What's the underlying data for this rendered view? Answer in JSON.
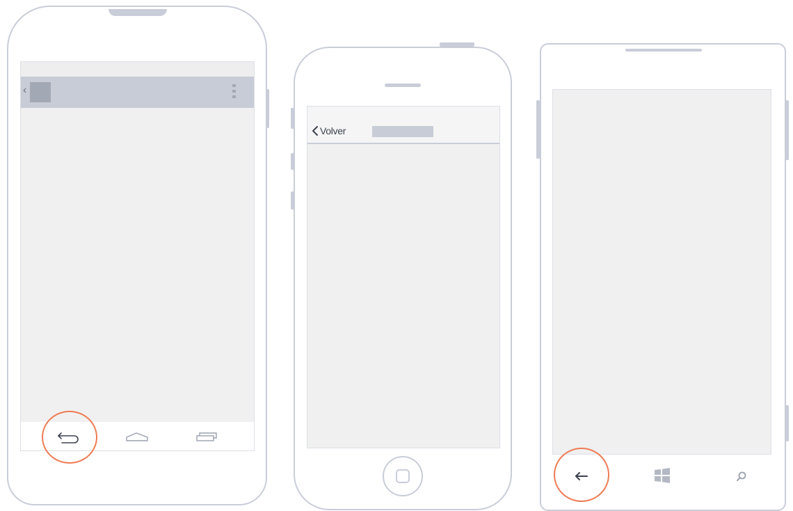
{
  "devices": {
    "android": {
      "buttons": [
        "back",
        "home",
        "recent-apps"
      ],
      "highlighted_button": "back"
    },
    "iphone": {
      "back_label": "Volver"
    },
    "windows_phone": {
      "buttons": [
        "back",
        "start",
        "search"
      ],
      "highlighted_button": "back"
    }
  },
  "colors": {
    "outline": "#c9cdd8",
    "screen": "#f0f0f0",
    "bar": "#c8ccd6",
    "highlight": "#ef7b54"
  }
}
